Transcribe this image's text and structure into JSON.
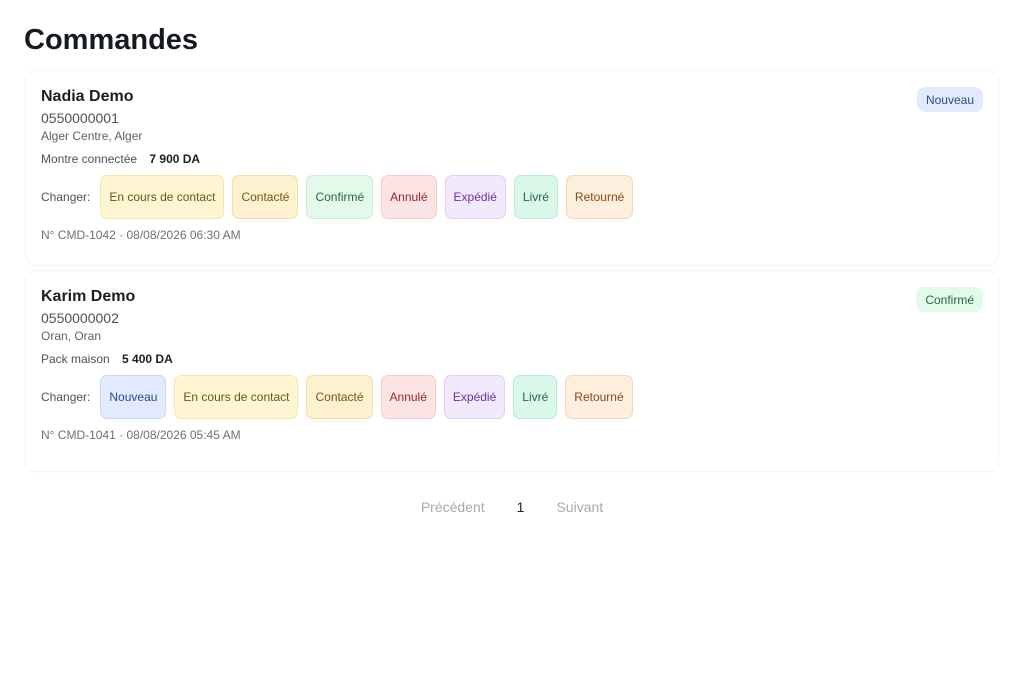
{
  "page": {
    "title": "Commandes"
  },
  "change_label": "Changer:",
  "orders": [
    {
      "name": "Nadia Demo",
      "phone": "0550000001",
      "address": "Alger Centre, Alger",
      "product": "Montre connectée",
      "price": "7 900 DA",
      "status": "Nouveau",
      "status_class": "st-nouveau",
      "meta": "N° CMD-1042 · 08/08/2026 06:30 AM",
      "actions": [
        {
          "label": "En cours de contact",
          "cls": "st-encours"
        },
        {
          "label": "Contacté",
          "cls": "st-contacte"
        },
        {
          "label": "Confirmé",
          "cls": "st-confirme"
        },
        {
          "label": "Annulé",
          "cls": "st-annule"
        },
        {
          "label": "Expédié",
          "cls": "st-expedie"
        },
        {
          "label": "Livré",
          "cls": "st-livre"
        },
        {
          "label": "Retourné",
          "cls": "st-retourne"
        }
      ]
    },
    {
      "name": "Karim Demo",
      "phone": "0550000002",
      "address": "Oran, Oran",
      "product": "Pack maison",
      "price": "5 400 DA",
      "status": "Confirmé",
      "status_class": "st-confirme",
      "meta": "N° CMD-1041 · 08/08/2026 05:45 AM",
      "actions": [
        {
          "label": "Nouveau",
          "cls": "st-nouveau"
        },
        {
          "label": "En cours de contact",
          "cls": "st-encours"
        },
        {
          "label": "Contacté",
          "cls": "st-contacte"
        },
        {
          "label": "Annulé",
          "cls": "st-annule"
        },
        {
          "label": "Expédié",
          "cls": "st-expedie"
        },
        {
          "label": "Livré",
          "cls": "st-livre"
        },
        {
          "label": "Retourné",
          "cls": "st-retourne"
        }
      ]
    }
  ],
  "pagination": {
    "prev": "Précédent",
    "current": "1",
    "next": "Suivant"
  }
}
